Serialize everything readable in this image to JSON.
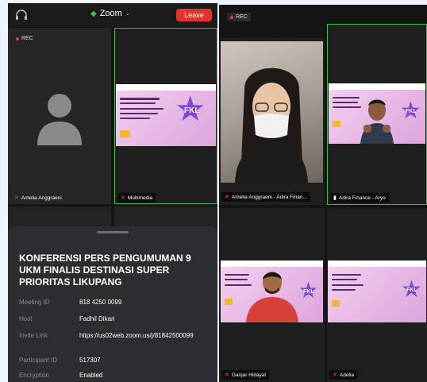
{
  "left": {
    "header": {
      "title": "Zoom",
      "leave_label": "Leave"
    },
    "rec_label": "REC",
    "tiles": [
      {
        "name": "Amelia Anggraeni"
      },
      {
        "name": "Multimedia"
      }
    ],
    "info": {
      "title": "KONFERENSI PERS PENGUMUMAN 9 UKM FINALIS DESTINASI SUPER PRIORITAS LIKUPANG",
      "rows": [
        {
          "key": "Meeting ID",
          "value": "818 4250 0099"
        },
        {
          "key": "Host",
          "value": "Fadhil Dikari"
        },
        {
          "key": "Invite Link",
          "value": "https://us02web.zoom.us/j/81842500099"
        },
        {
          "key": "Participant ID",
          "value": "517307"
        },
        {
          "key": "Encryption",
          "value": "Enabled"
        }
      ]
    }
  },
  "right": {
    "rec_label": "REC",
    "tiles": [
      {
        "name": "Amelia Anggraeni - Adira Finan..."
      },
      {
        "name": "Adira Finance - Aryo"
      },
      {
        "name": "Ganjar Hidayat"
      },
      {
        "name": "Adelia"
      }
    ]
  },
  "slide_badge": "FKL",
  "colors": {
    "accent_green": "#3fbf4a",
    "leave_red": "#e0352f",
    "muted_red": "#ff4a3d"
  }
}
